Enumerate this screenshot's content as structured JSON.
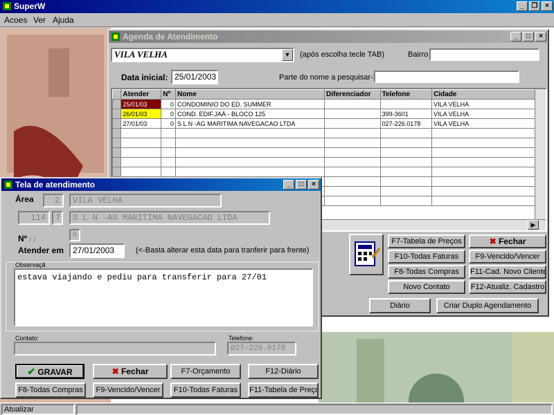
{
  "app": {
    "title": "SuperW",
    "menu": [
      "Acoes",
      "Ver",
      "Ajuda"
    ],
    "status": "Atualizar"
  },
  "agenda": {
    "title": "Agenda de Atendimento",
    "city_value": "VILA VELHA",
    "city_hint": "(após escolha tecle TAB)",
    "bairro_label": "Bairro",
    "bairro_value": "",
    "date_label": "Data inicial:",
    "date_value": "25/01/2003",
    "search_label": "Parte do nome a pesquisar->",
    "search_value": "",
    "columns": [
      "Atender",
      "Nº",
      "Nome",
      "Diferenciador",
      "Telefone",
      "Cidade"
    ],
    "rows": [
      {
        "atender": "25/01/03",
        "num": "0",
        "nome": "CONDOMINIO DO ED. SUMMER",
        "dif": "",
        "tel": "",
        "cidade": "VILA VELHA",
        "extra": "F",
        "hl": "#800000",
        "hlc": "#ffffff"
      },
      {
        "atender": "26/01/03",
        "num": "0",
        "nome": "COND. EDIF.JAÁ - BLOCO 125",
        "dif": "",
        "tel": "399-3601",
        "cidade": "VILA VELHA",
        "extra": "G",
        "hl": "#ffff00",
        "hlc": "#000000"
      },
      {
        "atender": "27/01/03",
        "num": "0",
        "nome": "S L N -AG MARITIMA NAVEGACAO LTDA",
        "dif": "",
        "tel": "027-226.0178",
        "cidade": "VILA VELHA",
        "extra": "I",
        "hl": "#ffffff",
        "hlc": "#000000"
      }
    ],
    "buttons": {
      "f7": "F7-Tabela de Preços",
      "fechar": "Fechar",
      "f10": "F10-Todas Faturas",
      "f9": "F9-Vencido/Vencer",
      "f8": "F8-Todas Compras",
      "f11": "F11-Cad. Novo Cliente",
      "novo": "Novo Contato",
      "f12": "F12-Atualiz. Cadastro",
      "diario": "Diário",
      "duplo": "Criar Duplo Agendamento"
    }
  },
  "tela": {
    "title": "Tela de atendimento",
    "area_label": "Área",
    "area_code": "2",
    "area_name": "VILA VELHA",
    "client_code": "114",
    "client_sub": "7",
    "client_name": "S L N -AG MARITIMA NAVEGACAO LTDA",
    "num_label": "Nº",
    "num_date_placeholder": "/ /",
    "num_value": "0",
    "atender_label": "Atender em",
    "atender_value": "27/01/2003",
    "atender_hint": "(<-Basta alterar esta data  para tranferir para frente)",
    "obs_label": "Observaçã",
    "obs_text": "estava viajando e pediu para transferir para 27/01",
    "contato_label": "Contato:",
    "contato_value": "",
    "telefone_label": "Telefone:",
    "telefone_value": "027-226.0178",
    "buttons": {
      "gravar": "GRAVAR",
      "fechar": "Fechar",
      "f7": "F7-Orçamento",
      "f12": "F12-Diário",
      "f8": "F8-Todas Compras",
      "f9": "F9-Vencido/Vencer",
      "f10": "F10-Todas Faturas",
      "f11": "F11-Tabela de Preço"
    }
  },
  "colors": {
    "title_active": "#000080",
    "title_inactive": "#808080",
    "face": "#c0c0c0",
    "check": "#008000",
    "x": "#c00000"
  }
}
